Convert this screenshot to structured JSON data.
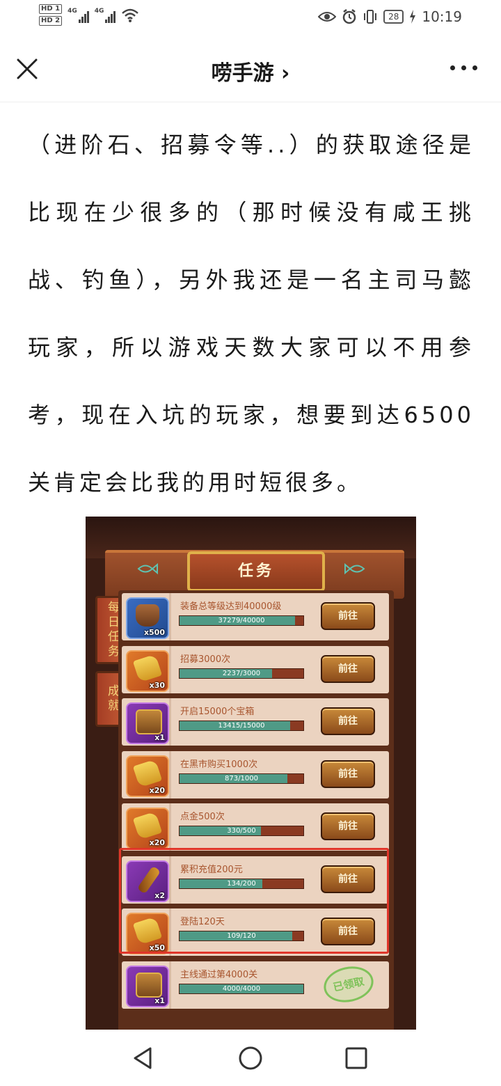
{
  "status_bar": {
    "hd1": "HD 1",
    "hd2": "HD 2",
    "signal1_label": "4G",
    "signal2_label": "4G",
    "battery": "28",
    "time": "10:19"
  },
  "navbar": {
    "title": "唠手游 ›"
  },
  "article": {
    "text": "（进阶石、招募令等..）的获取途径是比现在少很多的（那时候没有咸王挑战、钓鱼），另外我还是一名主司马懿玩家，所以游戏天数大家可以不用参考，现在入坑的玩家，想要到达6500关肯定会比我的用时短很多。"
  },
  "game": {
    "title": "任务",
    "tab_daily": "每日任务",
    "tab_achievement": "成就",
    "go_label": "前往",
    "claimed_label": "已领取",
    "tasks": [
      {
        "name": "装备总等级达到40000级",
        "progress_text": "37279/40000",
        "progress": 0.932,
        "qty": "x500",
        "icon": "armor-icon",
        "frame": "blue"
      },
      {
        "name": "招募3000次",
        "progress_text": "2237/3000",
        "progress": 0.746,
        "qty": "x30",
        "icon": "scroll-icon",
        "frame": "gold"
      },
      {
        "name": "开启15000个宝箱",
        "progress_text": "13415/15000",
        "progress": 0.894,
        "qty": "x1",
        "icon": "chest-icon",
        "frame": "purple"
      },
      {
        "name": "在黑市购买1000次",
        "progress_text": "873/1000",
        "progress": 0.873,
        "qty": "x20",
        "icon": "scroll-icon",
        "frame": "gold"
      },
      {
        "name": "点金500次",
        "progress_text": "330/500",
        "progress": 0.66,
        "qty": "x20",
        "icon": "scroll-icon",
        "frame": "gold"
      },
      {
        "name": "累积充值200元",
        "progress_text": "134/200",
        "progress": 0.67,
        "qty": "x2",
        "icon": "staff-icon",
        "frame": "purple"
      },
      {
        "name": "登陆120天",
        "progress_text": "109/120",
        "progress": 0.908,
        "qty": "x50",
        "icon": "scroll-icon",
        "frame": "gold"
      },
      {
        "name": "主线通过第4000关",
        "progress_text": "4000/4000",
        "progress": 1.0,
        "qty": "x1",
        "icon": "chest-icon",
        "frame": "purple",
        "claimed": true
      }
    ]
  },
  "colors": {
    "highlight": "#e0362a",
    "progress_fill": "#4f9a86",
    "task_name": "#a8552e"
  }
}
